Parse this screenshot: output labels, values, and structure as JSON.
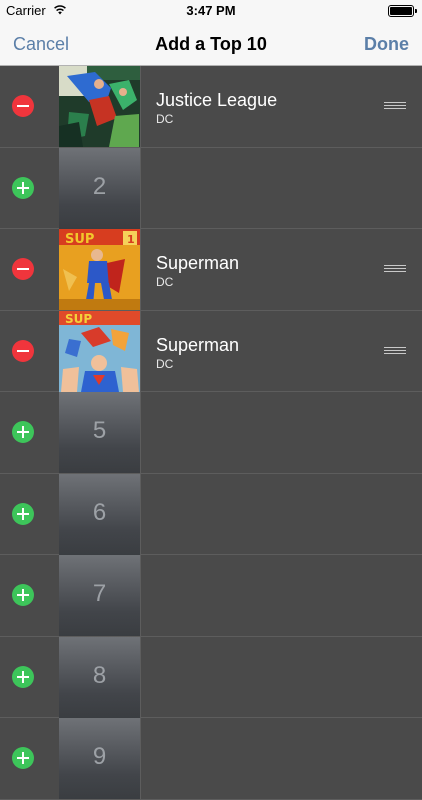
{
  "status": {
    "carrier": "Carrier",
    "time": "3:47 PM"
  },
  "nav": {
    "cancel": "Cancel",
    "title": "Add a Top 10",
    "done": "Done"
  },
  "rows": [
    {
      "kind": "comic",
      "name": "Justice League",
      "publisher": "DC",
      "cover": "justice-league-cover"
    },
    {
      "kind": "empty",
      "number": "2"
    },
    {
      "kind": "comic",
      "name": "Superman",
      "publisher": "DC",
      "cover": "superman-1-cover"
    },
    {
      "kind": "comic",
      "name": "Superman",
      "publisher": "DC",
      "cover": "superman-cover"
    },
    {
      "kind": "empty",
      "number": "5"
    },
    {
      "kind": "empty",
      "number": "6"
    },
    {
      "kind": "empty",
      "number": "7"
    },
    {
      "kind": "empty",
      "number": "8"
    },
    {
      "kind": "empty",
      "number": "9"
    }
  ],
  "colors": {
    "remove": "#f0353c",
    "add": "#3dc55a",
    "nav_tint": "#5b7fa8",
    "background": "#4a4a4a"
  }
}
